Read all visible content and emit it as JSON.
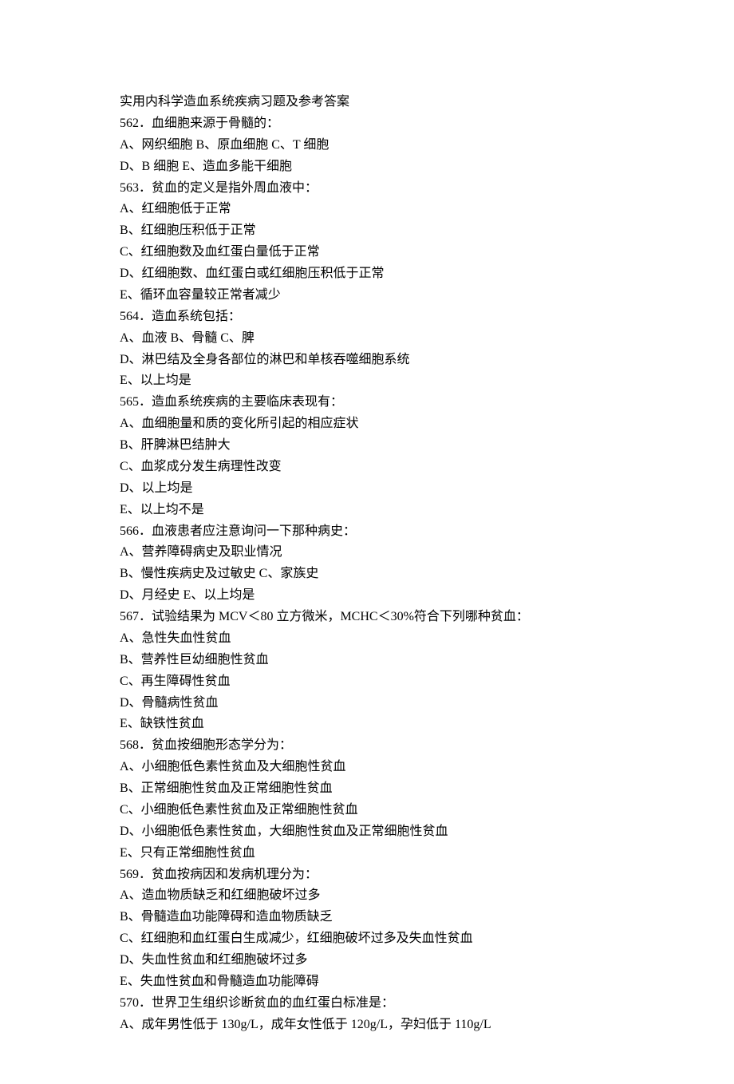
{
  "title": "实用内科学造血系统疾病习题及参考答案",
  "questions": [
    {
      "stem": "562．血细胞来源于骨髓的：",
      "lines": [
        "A、网织细胞 B、原血细胞 C、T 细胞",
        "D、B 细胞 E、造血多能干细胞"
      ]
    },
    {
      "stem": "563．贫血的定义是指外周血液中：",
      "lines": [
        "A、红细胞低于正常",
        "B、红细胞压积低于正常",
        "C、红细胞数及血红蛋白量低于正常",
        "D、红细胞数、血红蛋白或红细胞压积低于正常",
        "E、循环血容量较正常者减少"
      ]
    },
    {
      "stem": "564．造血系统包括：",
      "lines": [
        "A、血液 B、骨髓 C、脾",
        "D、淋巴结及全身各部位的淋巴和单核吞噬细胞系统",
        "E、以上均是"
      ]
    },
    {
      "stem": "565．造血系统疾病的主要临床表现有：",
      "lines": [
        "A、血细胞量和质的变化所引起的相应症状",
        "B、肝脾淋巴结肿大",
        "C、血浆成分发生病理性改变",
        "D、以上均是",
        "E、以上均不是"
      ]
    },
    {
      "stem": "566．血液患者应注意询问一下那种病史：",
      "lines": [
        "A、营养障碍病史及职业情况",
        "B、慢性疾病史及过敏史 C、家族史",
        "D、月经史 E、以上均是"
      ]
    },
    {
      "stem": "567．试验结果为 MCV＜80 立方微米，MCHC＜30%符合下列哪种贫血：",
      "lines": [
        "A、急性失血性贫血",
        "B、营养性巨幼细胞性贫血",
        "C、再生障碍性贫血",
        "D、骨髓病性贫血",
        "E、缺铁性贫血"
      ]
    },
    {
      "stem": "568．贫血按细胞形态学分为：",
      "lines": [
        "A、小细胞低色素性贫血及大细胞性贫血",
        "B、正常细胞性贫血及正常细胞性贫血",
        "C、小细胞低色素性贫血及正常细胞性贫血",
        "D、小细胞低色素性贫血，大细胞性贫血及正常细胞性贫血",
        "E、只有正常细胞性贫血"
      ]
    },
    {
      "stem": "569．贫血按病因和发病机理分为：",
      "lines": [
        "A、造血物质缺乏和红细胞破坏过多",
        "B、骨髓造血功能障碍和造血物质缺乏",
        "C、红细胞和血红蛋白生成减少，红细胞破坏过多及失血性贫血",
        "D、失血性贫血和红细胞破坏过多",
        "E、失血性贫血和骨髓造血功能障碍"
      ]
    },
    {
      "stem": "570．世界卫生组织诊断贫血的血红蛋白标准是：",
      "lines": [
        "A、成年男性低于 130g/L，成年女性低于 120g/L，孕妇低于 110g/L"
      ]
    }
  ]
}
